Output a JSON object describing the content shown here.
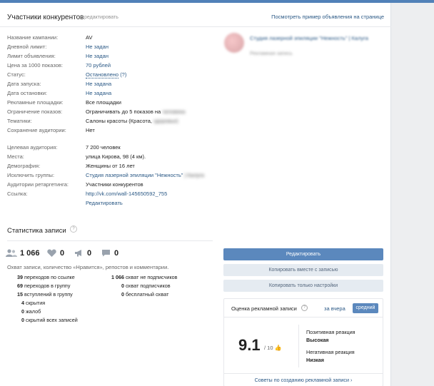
{
  "header": {
    "title": "Участники конкурентов",
    "edit_label": "редактировать",
    "preview_link": "Посмотреть пример объявления на странице"
  },
  "fields": [
    {
      "label": "Название кампании:",
      "value": "AV",
      "type": "text"
    },
    {
      "label": "Дневной лимит:",
      "value": "Не задан",
      "type": "link"
    },
    {
      "label": "Лимит объявления:",
      "value": "Не задан",
      "type": "link"
    },
    {
      "label": "Цена за 1000 показов:",
      "value": "70 рублей",
      "type": "link"
    },
    {
      "label": "Статус:",
      "value": "Остановлено",
      "type": "status"
    },
    {
      "label": "Дата запуска:",
      "value": "Не задана",
      "type": "link"
    },
    {
      "label": "Дата остановки:",
      "value": "Не задана",
      "type": "link"
    },
    {
      "label": "Рекламные площадки:",
      "value": "Все площадки",
      "type": "text"
    },
    {
      "label": "Ограничение показов:",
      "value": "Ограничивать до 5 показов на",
      "blurred": "человека",
      "type": "text"
    },
    {
      "label": "Тематики:",
      "value": "Салоны красоты (Красота,",
      "blurred": "здоровье)",
      "type": "text"
    },
    {
      "label": "Сохранение аудитории:",
      "value": "Нет",
      "type": "text"
    }
  ],
  "targeting": [
    {
      "label": "Целевая аудитория:",
      "value": "7 200 человек",
      "type": "text"
    },
    {
      "label": "Места:",
      "value": "улица Кирова, 98 (4 км).",
      "type": "text"
    },
    {
      "label": "Демография:",
      "value": "Женщины от 16 лет",
      "type": "text"
    },
    {
      "label": "Исключить группы:",
      "value": "Студия лазерной эпиляции \"Нежность\"",
      "blurred": "| Калуга",
      "type": "link"
    },
    {
      "label": "Аудитории ретаргетинга:",
      "value": "Участники конкурентов",
      "type": "text"
    },
    {
      "label": "Ссылка:",
      "value": "http://vk.com/wall-145650592_755",
      "type": "link"
    },
    {
      "label": "",
      "value": "Редактировать",
      "type": "link"
    }
  ],
  "status_help": "(?)",
  "stats": {
    "title": "Статистика записи",
    "help": "?",
    "reach": "1 066",
    "likes": "0",
    "reposts": "0",
    "comments": "0",
    "description": "Охват записи, количество «Нравится», репостов и комментарии.",
    "left_rows": [
      {
        "num": "39",
        "text": "переходов по ссылке"
      },
      {
        "num": "69",
        "text": "переходов в группу"
      },
      {
        "num": "15",
        "text": "вступлений в группу"
      },
      {
        "num": "4",
        "text": "скрытия"
      },
      {
        "num": "0",
        "text": "жалоб"
      },
      {
        "num": "0",
        "text": "скрытий всех записей"
      }
    ],
    "right_rows": [
      {
        "num": "1 066",
        "text": "охват не подписчиков"
      },
      {
        "num": "0",
        "text": "охват подписчиков"
      },
      {
        "num": "0",
        "text": "бесплатный охват"
      }
    ]
  },
  "preview": {
    "title": "Студия лазерной эпиляции \"Нежность\" | Калуга",
    "subtitle": "Рекламная запись"
  },
  "buttons": {
    "edit": "Редактировать",
    "copy_with_post": "Копировать вместе с записью",
    "copy_settings": "Копировать только настройки"
  },
  "score": {
    "title": "Оценка рекламной записи",
    "help": "?",
    "tab_yesterday": "за вчера",
    "tab_average": "средний",
    "value": "9.1",
    "out_of": "/ 10",
    "positive_label": "Позитивная реакция",
    "positive_value": "Высокая",
    "negative_label": "Негативная реакция",
    "negative_value": "Низкая",
    "tips_link": "Советы по созданию рекламной записи ›"
  }
}
